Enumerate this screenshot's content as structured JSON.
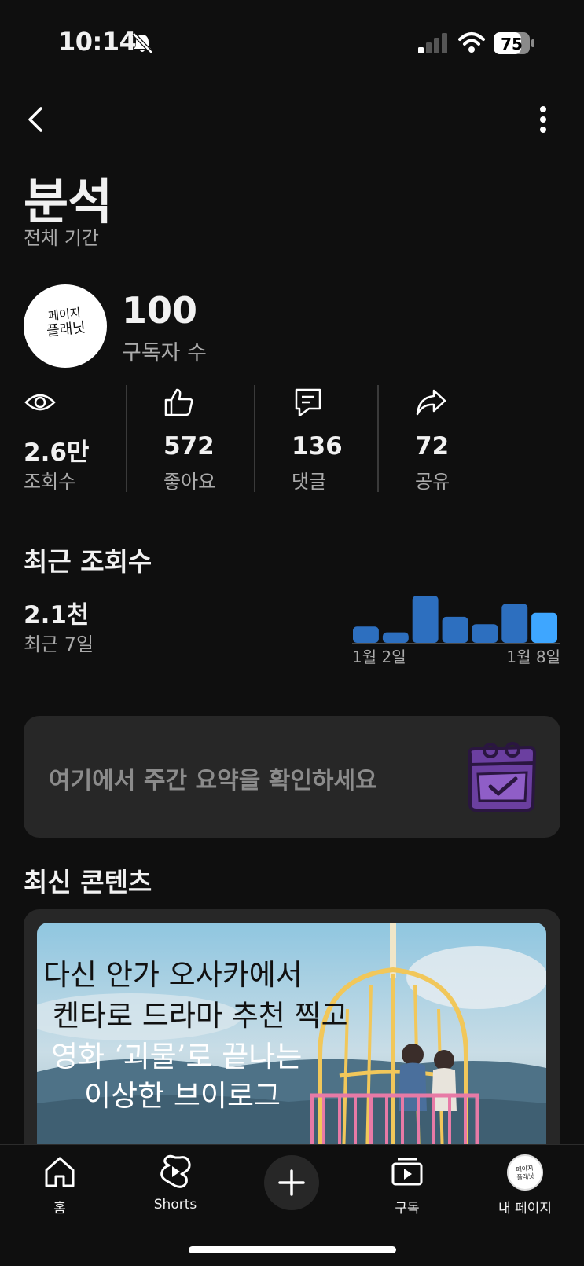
{
  "status_bar": {
    "time": "10:14",
    "battery_level": "75",
    "icons": [
      "bell-off-icon",
      "signal-icon",
      "wifi-icon",
      "battery-icon"
    ]
  },
  "header": {
    "title": "분석",
    "subtitle": "전체 기간"
  },
  "channel": {
    "avatar_text_line1": "페이지",
    "avatar_text_line2": "플래닛",
    "subscriber_count": "100",
    "subscriber_label": "구독자 수"
  },
  "stats": [
    {
      "icon": "eye-icon",
      "value": "2.6만",
      "label": "조회수"
    },
    {
      "icon": "thumbs-up-icon",
      "value": "572",
      "label": "좋아요"
    },
    {
      "icon": "comment-icon",
      "value": "136",
      "label": "댓글"
    },
    {
      "icon": "share-icon",
      "value": "72",
      "label": "공유"
    }
  ],
  "recent_views": {
    "title": "최근 조회수",
    "value": "2.1천",
    "period": "최근 7일"
  },
  "chart_data": {
    "type": "bar",
    "categories": [
      "1월 2일",
      "1월 3일",
      "1월 4일",
      "1월 5일",
      "1월 6일",
      "1월 7일",
      "1월 8일"
    ],
    "values": [
      20,
      13,
      58,
      32,
      23,
      48,
      37
    ],
    "ylim": [
      0,
      60
    ],
    "tick_labels": [
      "1월 2일",
      "1월 8일"
    ],
    "bar_color": "#2d6fbf",
    "highlight_color": "#3ea6ff",
    "grid": false
  },
  "summary_card": {
    "text": "여기에서 주간 요약을 확인하세요"
  },
  "latest_content": {
    "title": "최신 콘텐츠",
    "thumbnail_lines": [
      "다신 안가 오사카에서",
      "켄타로 드라마 추천 찍고",
      "영화 ‘괴물’로 끝나는",
      "이상한 브이로그"
    ]
  },
  "bottom_nav": [
    {
      "icon": "home-icon",
      "label": "홈"
    },
    {
      "icon": "shorts-icon",
      "label": "Shorts"
    },
    {
      "icon": "plus-icon",
      "label": ""
    },
    {
      "icon": "subscriptions-icon",
      "label": "구독"
    },
    {
      "icon": "profile-avatar-icon",
      "label": "내 페이지"
    }
  ],
  "colors": {
    "background": "#0f0f0f",
    "card": "#272727",
    "accent": "#3ea6ff",
    "calendar_purple": "#6b3fa0"
  }
}
